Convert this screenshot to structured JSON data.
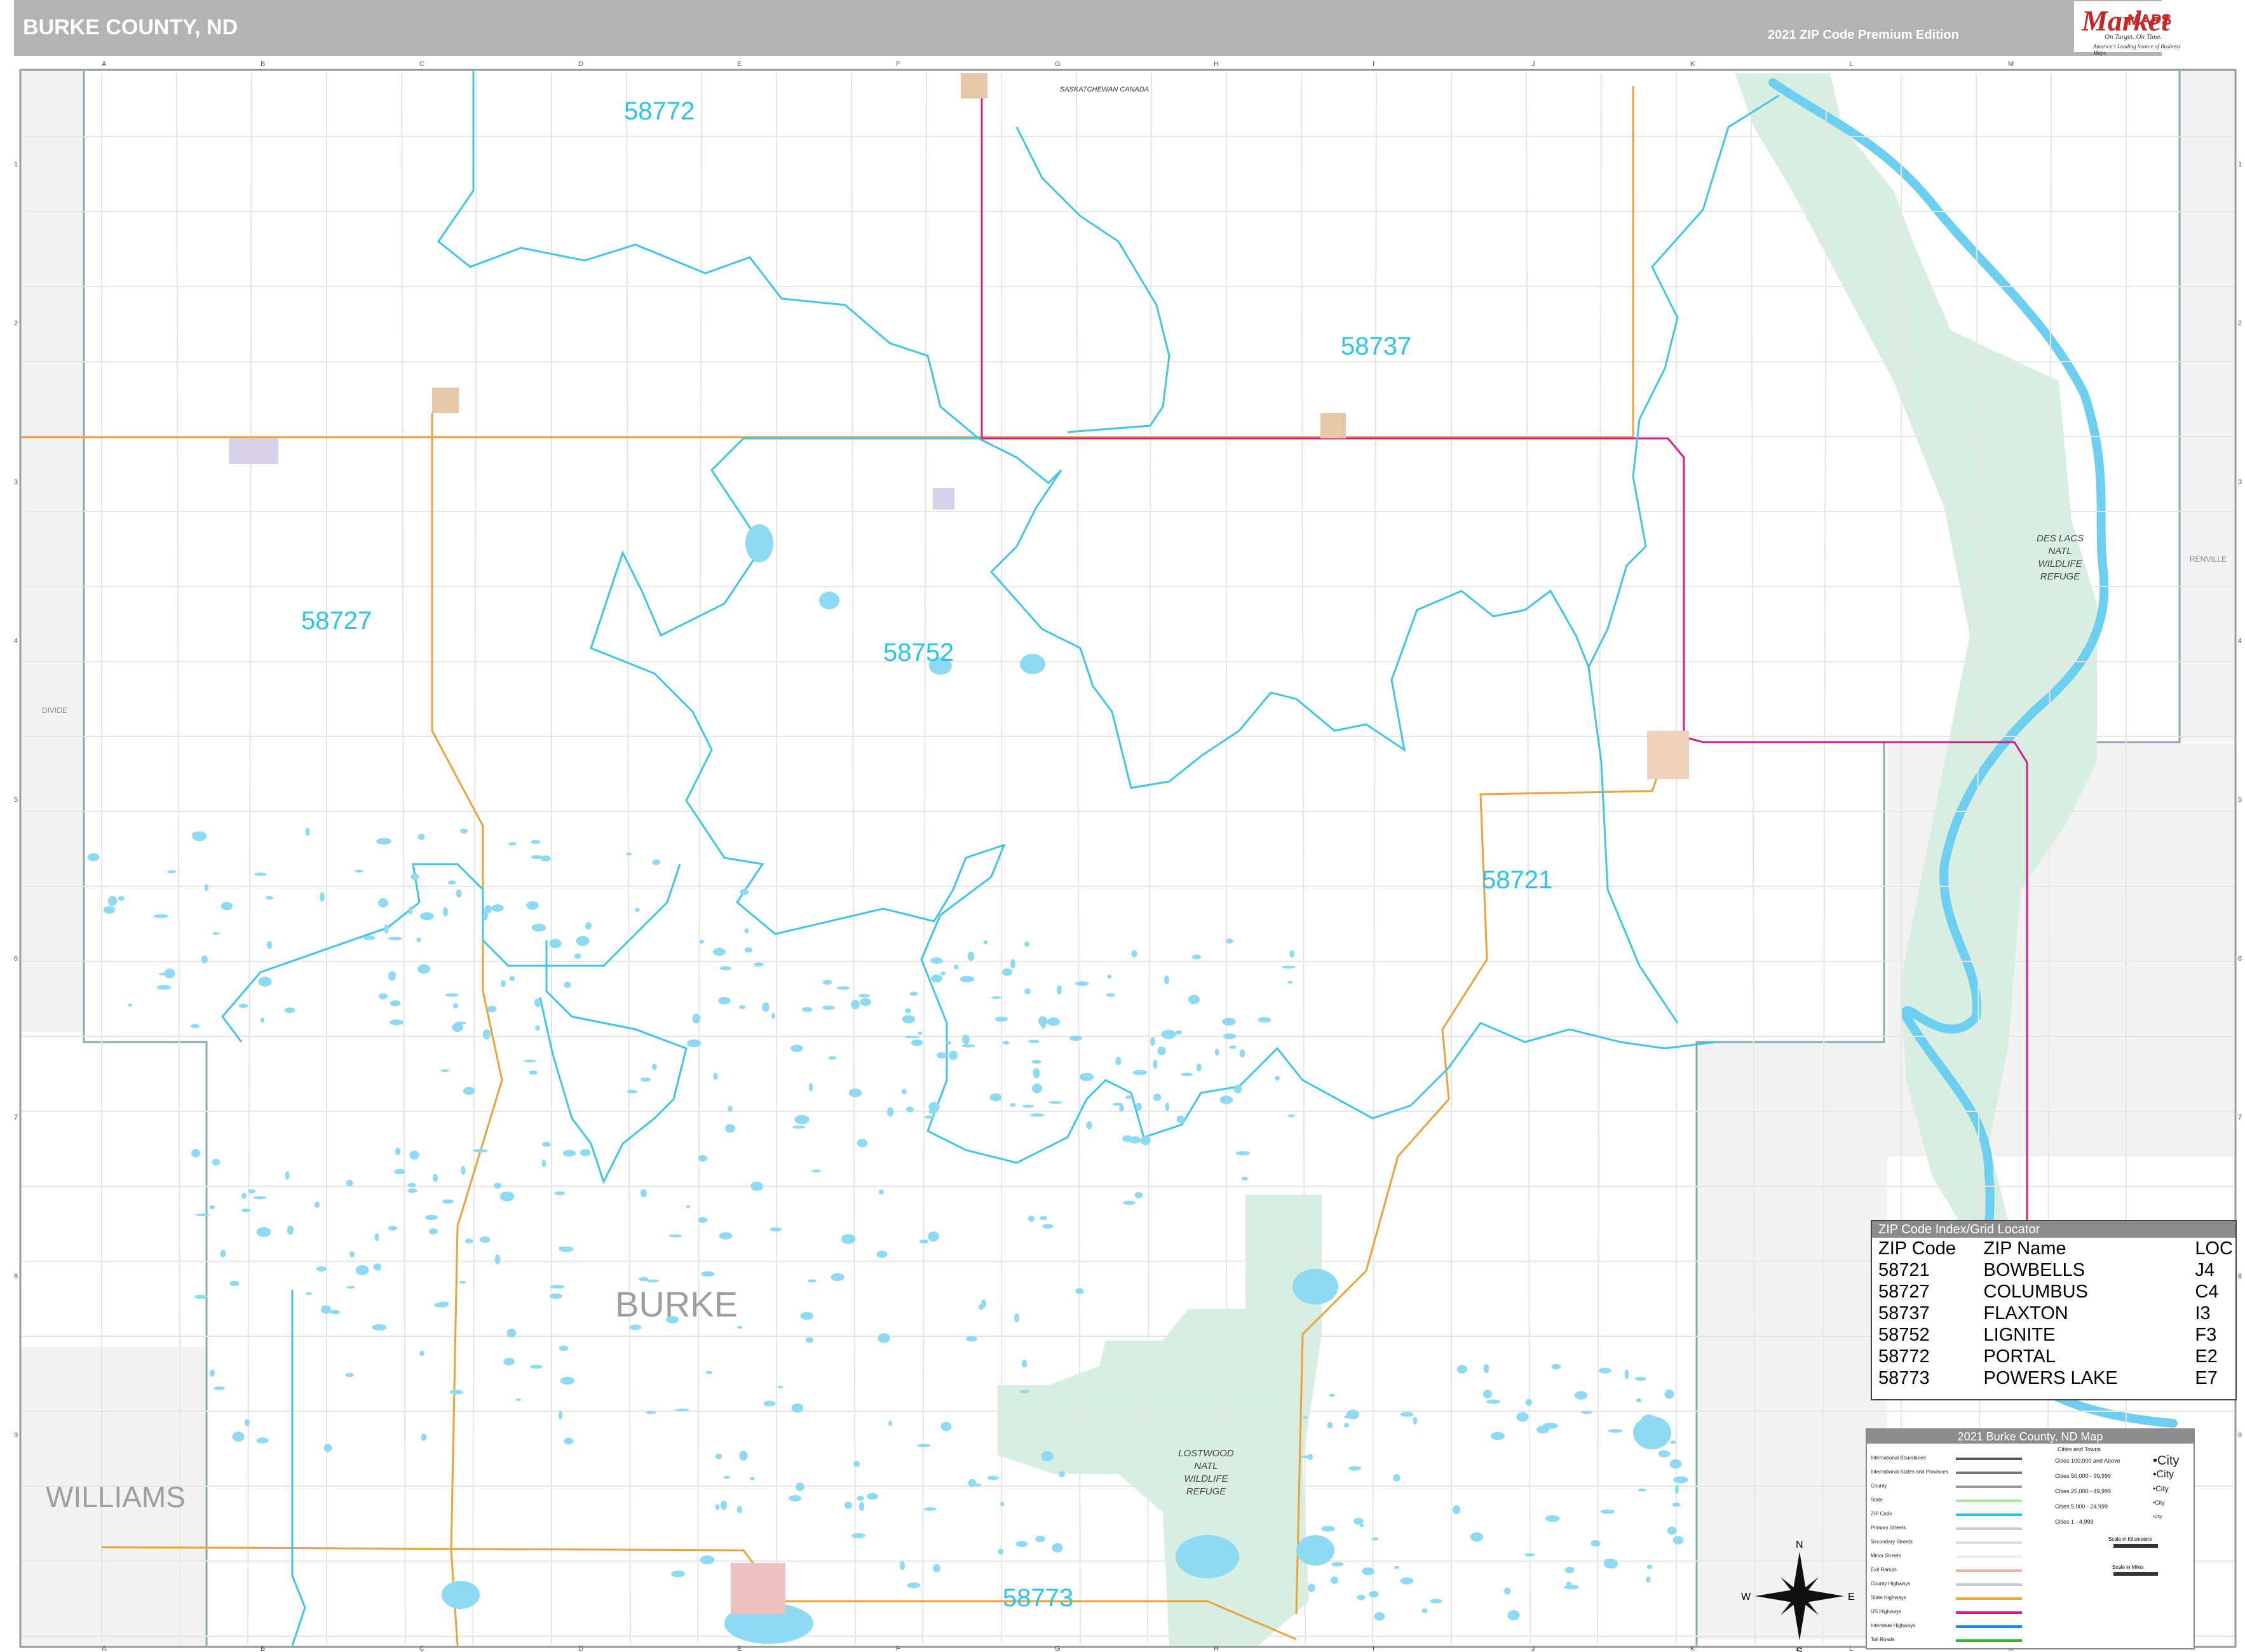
{
  "header": {
    "title": "BURKE COUNTY, ND",
    "edition": "2021 ZIP Code Premium Edition"
  },
  "logo": {
    "brand_first": "Market",
    "brand_second": "MAPS",
    "slogan": "On Target. On Time.",
    "tagline": "America's Leading Source of Business Maps"
  },
  "grid": {
    "columns": [
      "A",
      "B",
      "C",
      "D",
      "E",
      "F",
      "G",
      "H",
      "I",
      "J",
      "K",
      "L",
      "M"
    ],
    "rows": [
      "1",
      "2",
      "3",
      "4",
      "5",
      "6",
      "7",
      "8",
      "9"
    ]
  },
  "map_labels": {
    "county": "BURKE",
    "neighbor_west": "WILLIAMS",
    "neighbor_west_small": "DIVIDE",
    "neighbor_east_small": "RENVILLE",
    "country_border": "SASKATCHEWAN  CANADA",
    "refuge_east": [
      "DES LACS",
      "NATL",
      "WILDLIFE",
      "REFUGE"
    ],
    "refuge_south": [
      "LOSTWOOD",
      "NATL",
      "WILDLIFE",
      "REFUGE"
    ],
    "compass": {
      "n": "N",
      "s": "S",
      "e": "E",
      "w": "W"
    }
  },
  "zip_labels": [
    "58772",
    "58737",
    "58727",
    "58752",
    "58721",
    "58773"
  ],
  "zip_index": {
    "title": "ZIP Code Index/Grid Locator",
    "columns": [
      "ZIP Code",
      "ZIP Name",
      "LOC"
    ],
    "rows": [
      [
        "58721",
        "BOWBELLS",
        "J4"
      ],
      [
        "58727",
        "COLUMBUS",
        "C4"
      ],
      [
        "58737",
        "FLAXTON",
        "I3"
      ],
      [
        "58752",
        "LIGNITE",
        "F3"
      ],
      [
        "58772",
        "PORTAL",
        "E2"
      ],
      [
        "58773",
        "POWERS LAKE",
        "E7"
      ]
    ]
  },
  "legend": {
    "title": "2021 Burke County, ND Map",
    "items": [
      {
        "label": "International Boundaries",
        "color": "#555555"
      },
      {
        "label": "International States and Provinces",
        "color": "#777777"
      },
      {
        "label": "County",
        "color": "#999999"
      },
      {
        "label": "State",
        "color": "#aee8a0"
      },
      {
        "label": "ZIP Code",
        "color": "#29c4e6"
      },
      {
        "label": "Primary Streets",
        "color": "#cccccc"
      },
      {
        "label": "Secondary Streets",
        "color": "#dddddd"
      },
      {
        "label": "Minor Streets",
        "color": "#eeeeee"
      },
      {
        "label": "Exit Ramps",
        "color": "#e6b8a0"
      },
      {
        "label": "County Highways",
        "color": "#c8c8c8"
      },
      {
        "label": "State Highways",
        "color": "#f0a830"
      },
      {
        "label": "US Highways",
        "color": "#d81b8c"
      },
      {
        "label": "Interstate Highways",
        "color": "#1e88e5"
      },
      {
        "label": "Toll Roads",
        "color": "#22c322"
      }
    ],
    "cities_title": "Cities and Towns",
    "cities": [
      {
        "label": "Cities 100,000 and Above",
        "sample": "City"
      },
      {
        "label": "Cities 50,000 - 99,999",
        "sample": "City"
      },
      {
        "label": "Cities 25,000 - 49,999",
        "sample": "City"
      },
      {
        "label": "Cities 5,000 - 24,999",
        "sample": "City"
      },
      {
        "label": "Cities 1 - 4,999",
        "sample": "City"
      }
    ],
    "scale_km": "Scale in Kilometers",
    "scale_mi": "Scale in Miles"
  }
}
